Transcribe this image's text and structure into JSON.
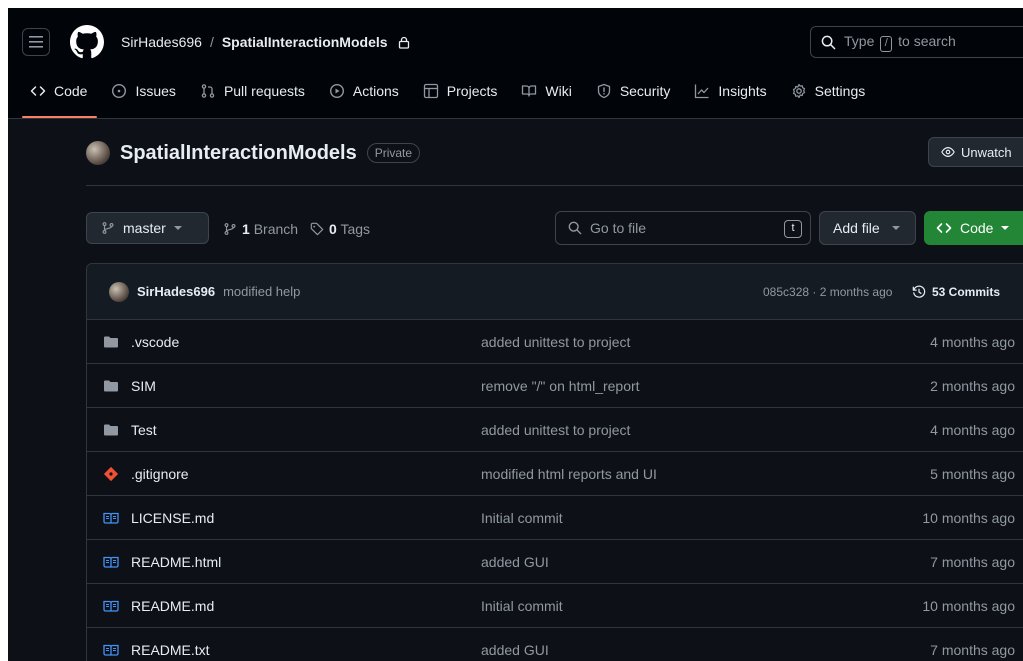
{
  "header": {
    "owner": "SirHades696",
    "separator": "/",
    "repo": "SpatialInteractionModels",
    "search_prefix": "Type",
    "search_key": "/",
    "search_suffix": "to search"
  },
  "tabs": [
    {
      "label": "Code",
      "icon": "code-icon",
      "active": true
    },
    {
      "label": "Issues",
      "icon": "issue-icon"
    },
    {
      "label": "Pull requests",
      "icon": "pull-request-icon"
    },
    {
      "label": "Actions",
      "icon": "play-icon"
    },
    {
      "label": "Projects",
      "icon": "table-icon"
    },
    {
      "label": "Wiki",
      "icon": "book-icon"
    },
    {
      "label": "Security",
      "icon": "shield-icon"
    },
    {
      "label": "Insights",
      "icon": "graph-icon"
    },
    {
      "label": "Settings",
      "icon": "gear-icon"
    }
  ],
  "repo_head": {
    "name": "SpatialInteractionModels",
    "visibility": "Private",
    "unwatch_label": "Unwatch"
  },
  "toolbar": {
    "branch": "master",
    "branch_count": "1",
    "branch_label": "Branch",
    "tag_count": "0",
    "tag_label": "Tags",
    "goto_placeholder": "Go to file",
    "goto_key": "t",
    "add_file_label": "Add file",
    "code_label": "Code"
  },
  "latest_commit": {
    "author": "SirHades696",
    "message": "modified help",
    "sha_age": "085c328 · 2 months ago",
    "commits_label": "53 Commits"
  },
  "files": [
    {
      "name": ".vscode",
      "type": "folder",
      "message": "added unittest to project",
      "age": "4 months ago"
    },
    {
      "name": "SIM",
      "type": "folder",
      "message": "remove \"/\" on html_report",
      "age": "2 months ago"
    },
    {
      "name": "Test",
      "type": "folder",
      "message": "added unittest to project",
      "age": "4 months ago"
    },
    {
      "name": ".gitignore",
      "type": "git",
      "message": "modified html reports and UI",
      "age": "5 months ago"
    },
    {
      "name": "LICENSE.md",
      "type": "book",
      "message": "Initial commit",
      "age": "10 months ago"
    },
    {
      "name": "README.html",
      "type": "book",
      "message": "added GUI",
      "age": "7 months ago"
    },
    {
      "name": "README.md",
      "type": "book",
      "message": "Initial commit",
      "age": "10 months ago"
    },
    {
      "name": "README.txt",
      "type": "book",
      "message": "added GUI",
      "age": "7 months ago"
    }
  ],
  "colors": {
    "background": "#0d1117",
    "header_bg": "#010409",
    "border": "#30363d",
    "accent_underline": "#f78166",
    "code_button": "#238636",
    "folder": "#9198a1",
    "git_file": "#f05133",
    "book_file": "#4493f8"
  }
}
